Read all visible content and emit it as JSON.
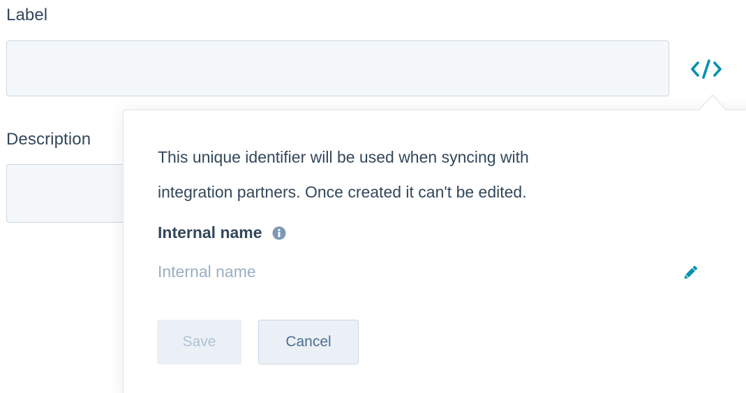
{
  "form": {
    "label_field": {
      "label": "Label",
      "value": "",
      "placeholder": ""
    },
    "description_field": {
      "label": "Description",
      "value": "",
      "placeholder": ""
    },
    "code_button_icon": "code-brackets-icon"
  },
  "popover": {
    "description_line1": "This unique identifier will be used when syncing with",
    "description_line2": "integration partners. Once created it can't be edited.",
    "internal_name_label": "Internal name",
    "info_icon": "info-circle-icon",
    "internal_name_value": "Internal name",
    "edit_icon": "pencil-icon",
    "save_label": "Save",
    "cancel_label": "Cancel"
  },
  "colors": {
    "accent": "#0091ae",
    "text": "#33475b",
    "muted_text": "#99afc4",
    "input_bg": "#f5f8fa",
    "input_border": "#cbd6e2",
    "info_icon": "#7c98b6",
    "button_bg": "#eaf0f6"
  }
}
